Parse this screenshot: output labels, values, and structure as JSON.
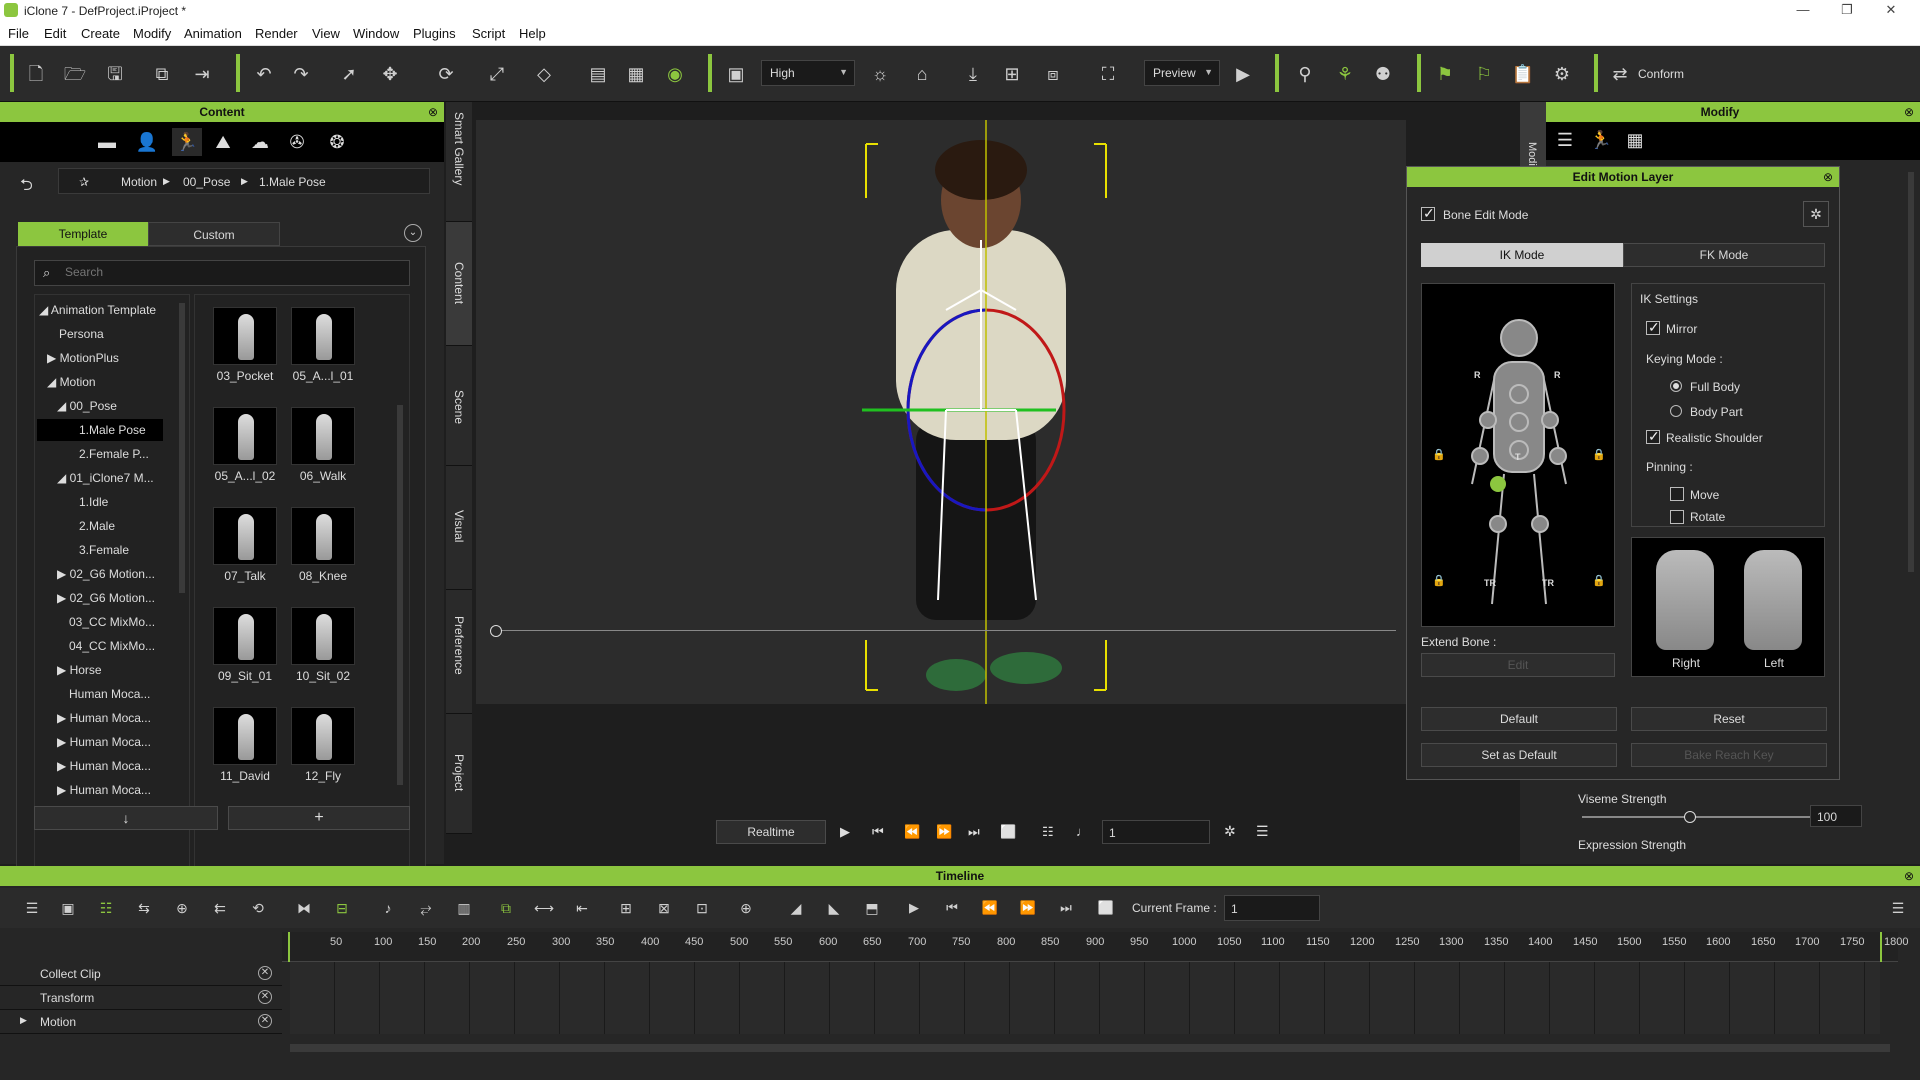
{
  "window": {
    "title": "iClone 7 - DefProject.iProject *",
    "controls": [
      "—",
      "❐",
      "✕"
    ]
  },
  "menu": [
    "File",
    "Edit",
    "Create",
    "Modify",
    "Animation",
    "Render",
    "View",
    "Window",
    "Plugins",
    "Script",
    "Help"
  ],
  "toolbar": {
    "quality": "High",
    "render_mode": "Preview",
    "conform": "Conform"
  },
  "content": {
    "title": "Content",
    "breadcrumb": [
      "Motion",
      "00_Pose",
      "1.Male Pose"
    ],
    "tabs": {
      "template": "Template",
      "custom": "Custom"
    },
    "search_placeholder": "Search",
    "tree": [
      "Animation Template",
      "Persona",
      "MotionPlus",
      "Motion",
      "00_Pose",
      "1.Male Pose",
      "2.Female P...",
      "01_iClone7 M...",
      "1.Idle",
      "2.Male",
      "3.Female",
      "02_G6 Motion...",
      "02_G6 Motion...",
      "03_CC MixMo...",
      "04_CC MixMo...",
      "Horse",
      "Human Moca...",
      "Human Moca...",
      "Human Moca...",
      "Human Moca...",
      "Human Moca..."
    ],
    "thumbs": [
      "03_Pocket",
      "05_A...l_01",
      "05_A...l_02",
      "06_Walk",
      "07_Talk",
      "08_Knee",
      "09_Sit_01",
      "10_Sit_02",
      "11_David",
      "12_Fly"
    ]
  },
  "side_tabs": [
    "Smart Gallery",
    "Content",
    "Scene",
    "Visual",
    "Preference",
    "Project"
  ],
  "playback": {
    "mode": "Realtime",
    "frame": "1"
  },
  "modify": {
    "title": "Modify",
    "side_tab": "Modify",
    "viseme": "Viseme Strength",
    "viseme_value": "100",
    "expression": "Expression Strength"
  },
  "motion_layer": {
    "title": "Edit Motion Layer",
    "bone_edit": "Bone Edit Mode",
    "ik": "IK Mode",
    "fk": "FK Mode",
    "ik_settings": "IK Settings",
    "mirror": "Mirror",
    "keying": "Keying Mode :",
    "full_body": "Full Body",
    "body_part": "Body Part",
    "realistic": "Realistic Shoulder",
    "pinning": "Pinning :",
    "move": "Move",
    "rotate": "Rotate",
    "extend_bone": "Extend Bone :",
    "edit": "Edit",
    "right": "Right",
    "left": "Left",
    "default": "Default",
    "reset": "Reset",
    "set_default": "Set as Default",
    "bake": "Bake Reach Key",
    "markers": {
      "r": "R",
      "t": "T",
      "tr": "TR"
    }
  },
  "timeline": {
    "title": "Timeline",
    "current_frame_label": "Current Frame :",
    "current_frame": "1",
    "ticks": [
      "50",
      "100",
      "150",
      "200",
      "250",
      "300",
      "350",
      "400",
      "450",
      "500",
      "550",
      "600",
      "650",
      "700",
      "750",
      "800",
      "850",
      "900",
      "950",
      "1000",
      "1050",
      "1100",
      "1150",
      "1200",
      "1250",
      "1300",
      "1350",
      "1400",
      "1450",
      "1500",
      "1550",
      "1600",
      "1650",
      "1700",
      "1750",
      "1800"
    ],
    "tracks": [
      "Collect Clip",
      "Transform",
      "Motion"
    ]
  },
  "colors": {
    "accent": "#8cc63f"
  }
}
